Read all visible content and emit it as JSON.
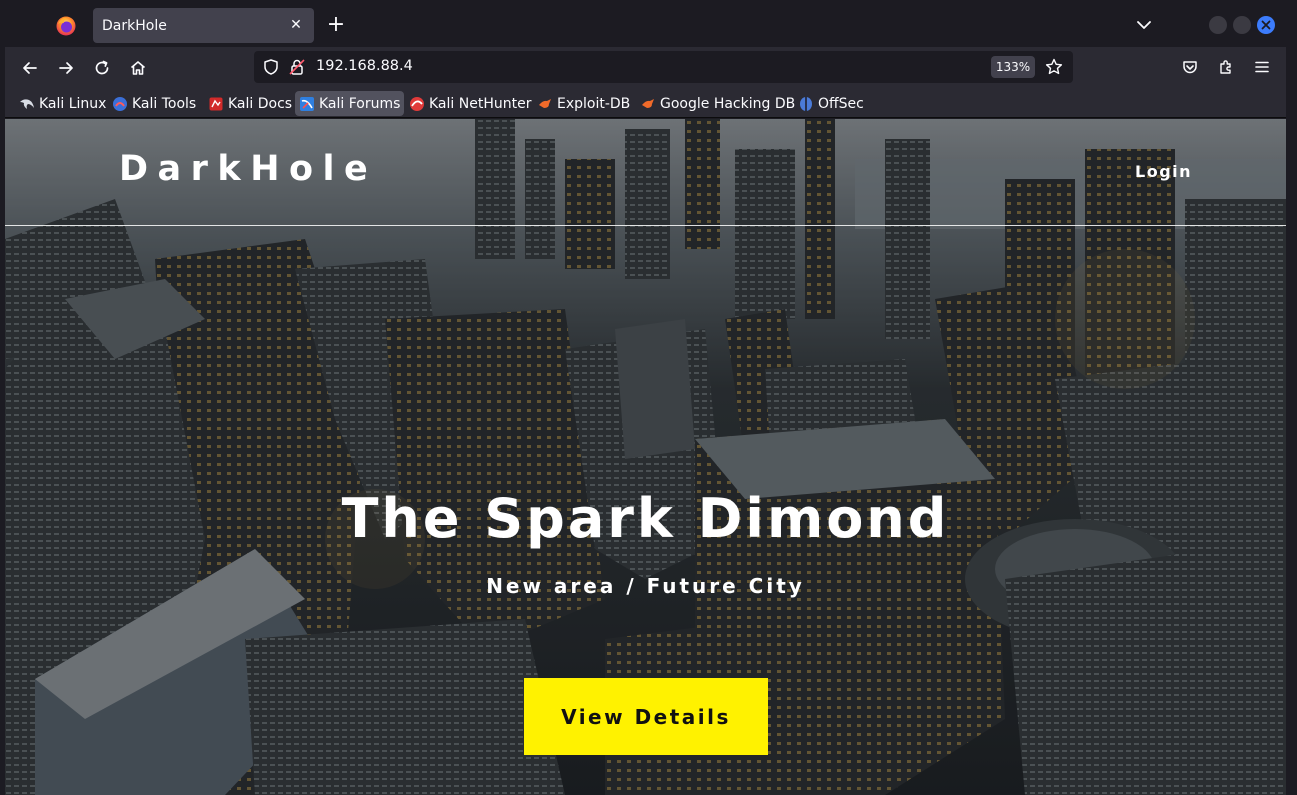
{
  "browser": {
    "tab": {
      "title": "DarkHole",
      "close_icon": "close-icon"
    },
    "new_tab_icon": "plus-icon",
    "url": "192.168.88.4",
    "zoom": "133%",
    "bookmarks": [
      {
        "label": "Kali Linux",
        "icon": "kali-dragon-icon"
      },
      {
        "label": "Kali Tools",
        "icon": "kali-tools-icon"
      },
      {
        "label": "Kali Docs",
        "icon": "kali-docs-icon"
      },
      {
        "label": "Kali Forums",
        "icon": "kali-forums-icon"
      },
      {
        "label": "Kali NetHunter",
        "icon": "kali-nethunter-icon"
      },
      {
        "label": "Exploit-DB",
        "icon": "exploit-db-icon"
      },
      {
        "label": "Google Hacking DB",
        "icon": "ghdb-icon"
      },
      {
        "label": "OffSec",
        "icon": "offsec-icon"
      }
    ],
    "colors": {
      "chrome_dark": "#1c1b22",
      "toolbar": "#2b2a33",
      "tab_active": "#42414d",
      "window_close": "#3c7cfc"
    }
  },
  "page": {
    "logo": "DarkHole",
    "nav_login": "Login",
    "hero_title": "The Spark Dimond",
    "hero_subtitle": "New area / Future City",
    "cta_label": "View Details",
    "colors": {
      "cta_bg": "#fff200",
      "cta_text": "#111111"
    }
  }
}
